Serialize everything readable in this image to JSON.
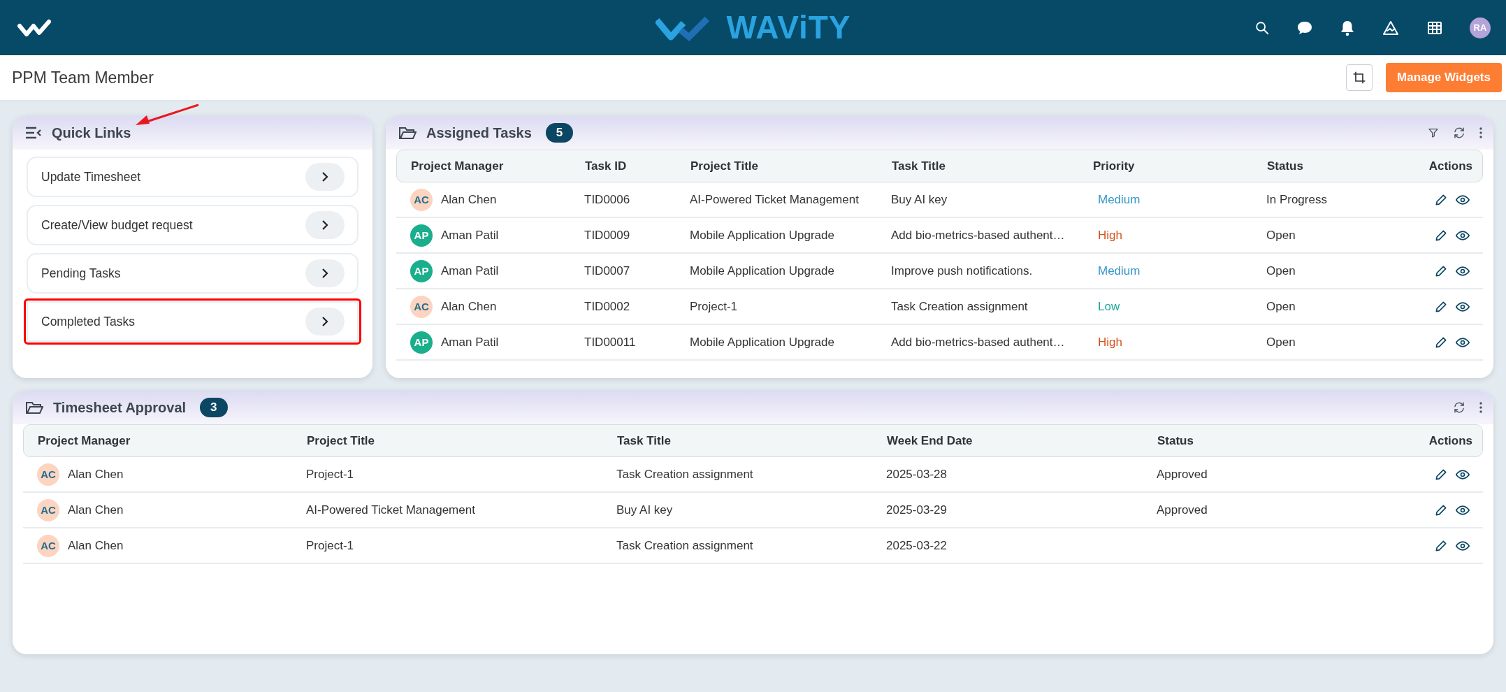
{
  "header": {
    "logo_text": "WAViTY",
    "user_initials": "RA"
  },
  "page": {
    "title": "PPM Team Member",
    "manage_button": "Manage Widgets"
  },
  "quick_links": {
    "title": "Quick Links",
    "items": [
      {
        "label": "Update Timesheet",
        "annotated": false
      },
      {
        "label": "Create/View budget request",
        "annotated": false
      },
      {
        "label": "Pending Tasks",
        "annotated": false
      },
      {
        "label": "Completed Tasks",
        "annotated": true
      }
    ]
  },
  "widgets": [
    {
      "kind": "assigned",
      "title": "Assigned Tasks",
      "count": "5",
      "filter": true,
      "columns": [
        "Project Manager",
        "Task ID",
        "Project Title",
        "Task Title",
        "Priority",
        "Status",
        "Actions"
      ],
      "rows": [
        [
          {
            "kind": "person",
            "initials": "AC",
            "name": "Alan Chen",
            "color": "#fcd4bf"
          },
          {
            "kind": "text",
            "text": "TID0006"
          },
          {
            "kind": "text",
            "text": "AI-Powered Ticket Management"
          },
          {
            "kind": "text",
            "text": "Buy AI key"
          },
          {
            "kind": "tag",
            "text": "Medium",
            "color": "#3597c9"
          },
          {
            "kind": "text",
            "text": "In Progress"
          },
          {
            "kind": "actions"
          }
        ],
        [
          {
            "kind": "person",
            "initials": "AP",
            "name": "Aman Patil",
            "color": "#1aae8c"
          },
          {
            "kind": "text",
            "text": "TID0009"
          },
          {
            "kind": "text",
            "text": "Mobile Application Upgrade"
          },
          {
            "kind": "text",
            "text": "Add bio-metrics-based authent…"
          },
          {
            "kind": "tag",
            "text": "High",
            "color": "#d4521c"
          },
          {
            "kind": "text",
            "text": "Open"
          },
          {
            "kind": "actions"
          }
        ],
        [
          {
            "kind": "person",
            "initials": "AP",
            "name": "Aman Patil",
            "color": "#1aae8c"
          },
          {
            "kind": "text",
            "text": "TID0007"
          },
          {
            "kind": "text",
            "text": "Mobile Application Upgrade"
          },
          {
            "kind": "text",
            "text": "Improve push notifications."
          },
          {
            "kind": "tag",
            "text": "Medium",
            "color": "#3597c9"
          },
          {
            "kind": "text",
            "text": "Open"
          },
          {
            "kind": "actions"
          }
        ],
        [
          {
            "kind": "person",
            "initials": "AC",
            "name": "Alan Chen",
            "color": "#fcd4bf"
          },
          {
            "kind": "text",
            "text": "TID0002"
          },
          {
            "kind": "text",
            "text": "Project-1"
          },
          {
            "kind": "text",
            "text": "Task Creation assignment"
          },
          {
            "kind": "tag",
            "text": "Low",
            "color": "#18a999"
          },
          {
            "kind": "text",
            "text": "Open"
          },
          {
            "kind": "actions"
          }
        ],
        [
          {
            "kind": "person",
            "initials": "AP",
            "name": "Aman Patil",
            "color": "#1aae8c"
          },
          {
            "kind": "text",
            "text": "TID00011"
          },
          {
            "kind": "text",
            "text": "Mobile Application Upgrade"
          },
          {
            "kind": "text",
            "text": "Add bio-metrics-based authent…"
          },
          {
            "kind": "tag",
            "text": "High",
            "color": "#d4521c"
          },
          {
            "kind": "text",
            "text": "Open"
          },
          {
            "kind": "actions"
          }
        ]
      ]
    },
    {
      "kind": "timesheet",
      "title": "Timesheet Approval",
      "count": "3",
      "filter": false,
      "columns": [
        "Project Manager",
        "Project Title",
        "Task Title",
        "Week End Date",
        "Status",
        "Actions"
      ],
      "rows": [
        [
          {
            "kind": "person",
            "initials": "AC",
            "name": "Alan Chen",
            "color": "#fcd4bf"
          },
          {
            "kind": "text",
            "text": "Project-1"
          },
          {
            "kind": "text",
            "text": "Task Creation assignment"
          },
          {
            "kind": "text",
            "text": "2025-03-28"
          },
          {
            "kind": "text",
            "text": "Approved"
          },
          {
            "kind": "actions"
          }
        ],
        [
          {
            "kind": "person",
            "initials": "AC",
            "name": "Alan Chen",
            "color": "#fcd4bf"
          },
          {
            "kind": "text",
            "text": "AI-Powered Ticket Management"
          },
          {
            "kind": "text",
            "text": "Buy AI key"
          },
          {
            "kind": "text",
            "text": "2025-03-29"
          },
          {
            "kind": "text",
            "text": "Approved"
          },
          {
            "kind": "actions"
          }
        ],
        [
          {
            "kind": "person",
            "initials": "AC",
            "name": "Alan Chen",
            "color": "#fcd4bf"
          },
          {
            "kind": "text",
            "text": "Project-1"
          },
          {
            "kind": "text",
            "text": "Task Creation assignment"
          },
          {
            "kind": "text",
            "text": "2025-03-22"
          },
          {
            "kind": "actions"
          }
        ]
      ]
    }
  ]
}
